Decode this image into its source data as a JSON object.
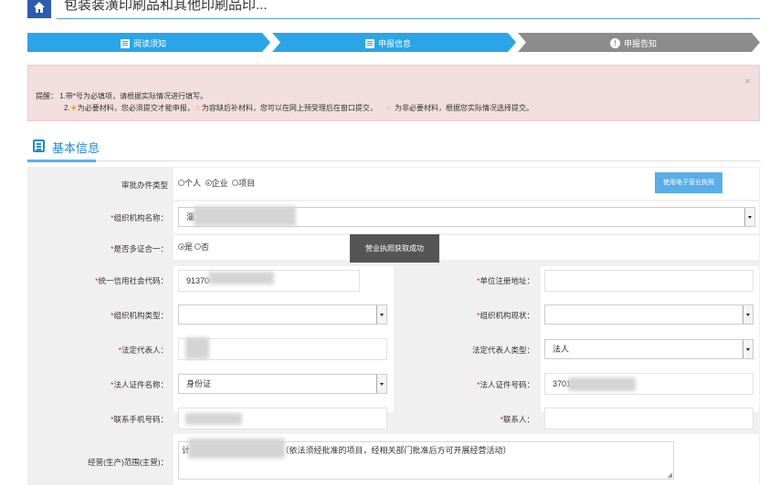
{
  "header": {
    "title": "包装装潢印刷品和其他印刷品印..."
  },
  "steps": [
    {
      "label": "阅读须知"
    },
    {
      "label": "申报信息"
    },
    {
      "label": "申报告知"
    }
  ],
  "alert": {
    "close": "×",
    "line1": "提醒： 1.带*号为必填项，请根据实际情况进行填写。",
    "line2_a": "2.",
    "line2_b": "为必要材料，您必须提交才能申报，",
    "line2_c": "为容缺后补材料，您可以在网上预受理后在窗口提交，",
    "line2_d": "为非必要材料，根据您实际情况选择提交。"
  },
  "section": {
    "title": "基本信息"
  },
  "form": {
    "type_label": "审批办件类型",
    "type_options": [
      "个人",
      "企业",
      "项目"
    ],
    "type_selected": "企业",
    "elicense_button": "使用电子营业执照",
    "org_name_label": "组织机构名称：",
    "org_name_value": "淄",
    "multi_cert_label": "是否多证合一：",
    "multi_cert_options": [
      "是",
      "否"
    ],
    "multi_cert_selected": "是",
    "toast": "营业执照获取成功",
    "credit_code_label": "统一信用社会代码：",
    "credit_code_value": "91370",
    "reg_addr_label": "单位注册地址：",
    "reg_addr_value": "",
    "org_type_label": "组织机构类型：",
    "org_type_value": "",
    "org_status_label": "组织机构现状：",
    "org_status_value": "",
    "legal_rep_label": "法定代表人：",
    "legal_rep_value": "",
    "legal_rep_type_label": "法定代表人类型：",
    "legal_rep_type_value": "法人",
    "id_name_label": "法人证件名称：",
    "id_name_value": "身份证",
    "id_no_label": "法人证件号码：",
    "id_no_value": "3701",
    "phone_label": "联系手机号码：",
    "phone_value": "",
    "contact_label": "联系人：",
    "contact_value": "",
    "scope_label": "经营(生产)范围(主营)：",
    "scope_prefix": "计",
    "scope_value": "售。（依法须经批准的项目，经相关部门批准后方可开展经营活动）"
  }
}
